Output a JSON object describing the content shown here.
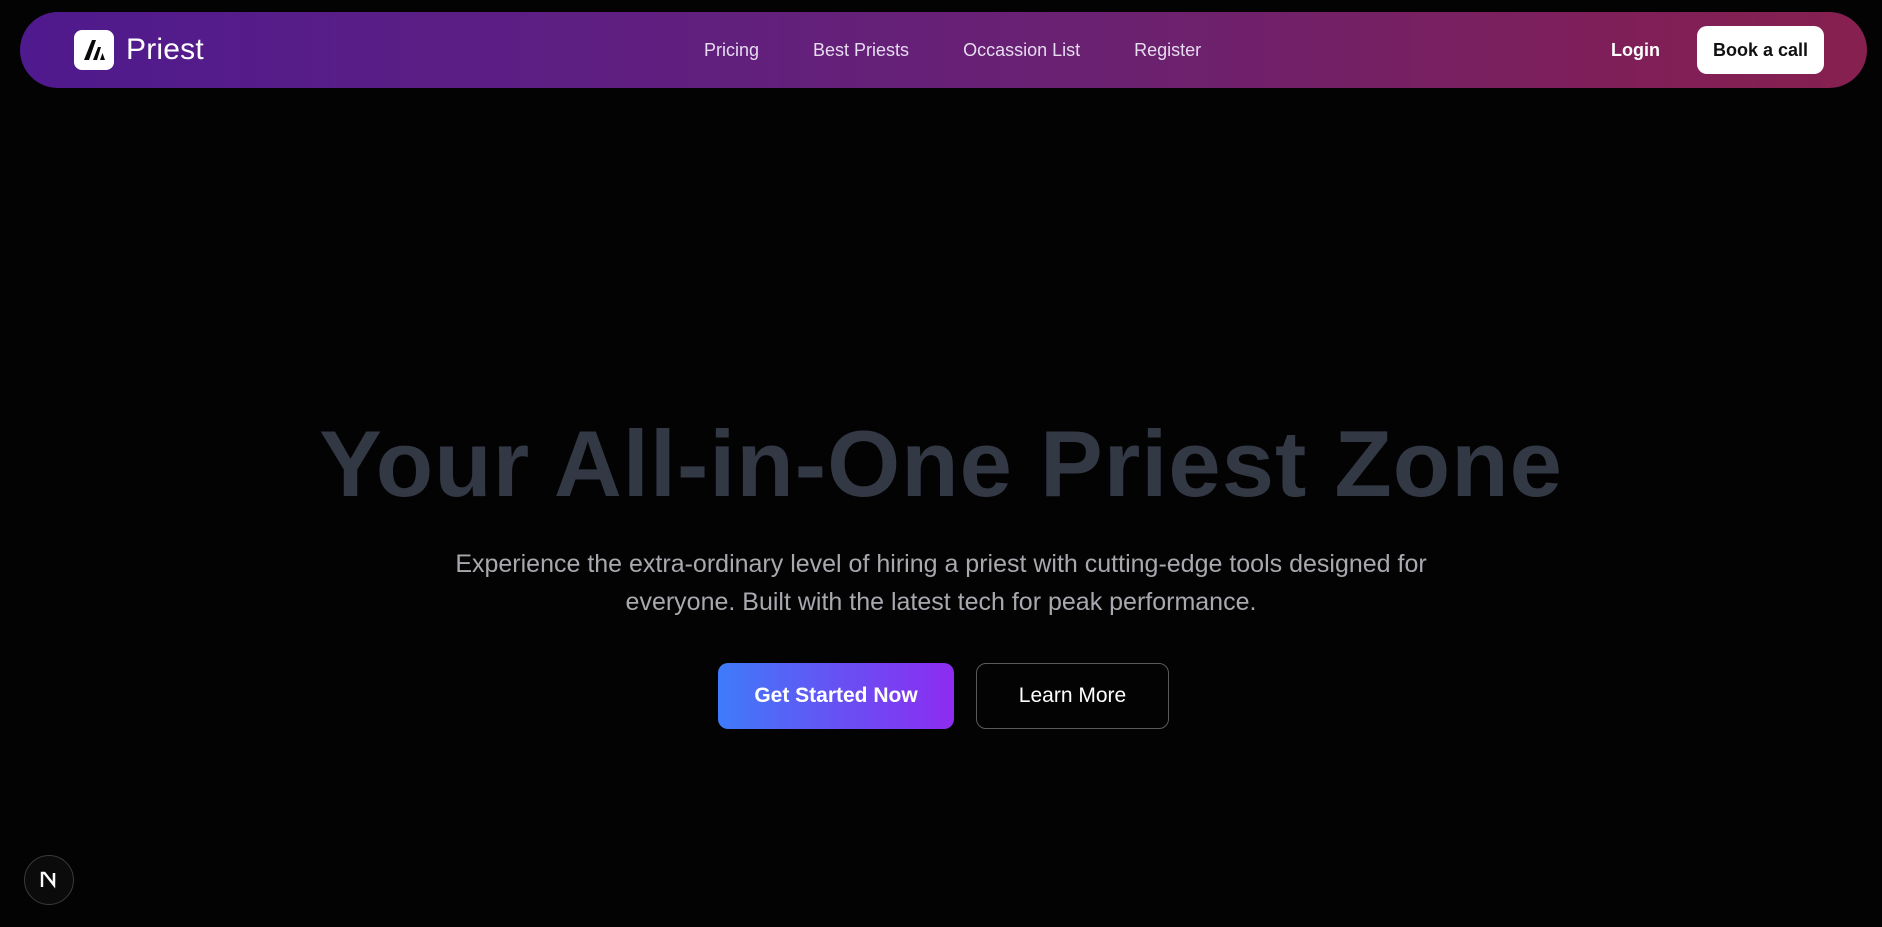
{
  "navbar": {
    "brand": {
      "name": "Priest",
      "logo_icon": "stylized-a-logo-icon"
    },
    "links": [
      {
        "label": "Pricing"
      },
      {
        "label": "Best Priests"
      },
      {
        "label": "Occassion List"
      },
      {
        "label": "Register"
      }
    ],
    "login_label": "Login",
    "cta_label": "Book a call"
  },
  "hero": {
    "title": "Your All-in-One Priest Zone",
    "subtitle": "Experience the extra-ordinary level of hiring a priest with cutting-edge tools designed for everyone. Built with the latest tech for peak performance.",
    "primary_button": "Get Started Now",
    "secondary_button": "Learn More"
  },
  "dev_indicator": {
    "icon": "nextjs-n-icon",
    "letter": "N"
  },
  "colors": {
    "background": "#030303",
    "navbar_gradient_start": "#4f1a8e",
    "navbar_gradient_end": "#86204f",
    "title_color": "#323844",
    "cta_gradient_start": "#3f7bfa",
    "cta_gradient_end": "#8d2cf0"
  }
}
